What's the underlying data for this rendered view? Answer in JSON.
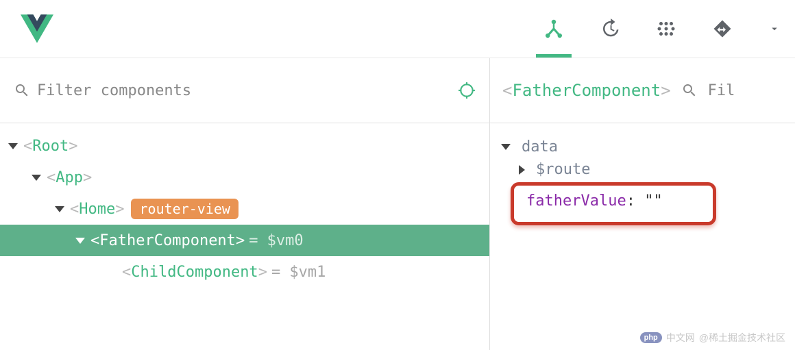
{
  "filter": {
    "placeholder": "Filter components"
  },
  "tree": {
    "root": {
      "name": "Root"
    },
    "app": {
      "name": "App"
    },
    "home": {
      "name": "Home",
      "badge": "router-view"
    },
    "father": {
      "name": "FatherComponent",
      "vm": " = $vm0"
    },
    "child": {
      "name": "ChildComponent",
      "vm": " = $vm1"
    }
  },
  "right": {
    "title": "FatherComponent",
    "filter_placeholder": "Filt",
    "section": "data",
    "routeProp": "$route",
    "highlight": {
      "key": "fatherValue",
      "colon": ": ",
      "value": "\"\""
    }
  },
  "watermarks": {
    "php": "php",
    "cn": "中文网",
    "attr": "@稀土掘金技术社区"
  }
}
